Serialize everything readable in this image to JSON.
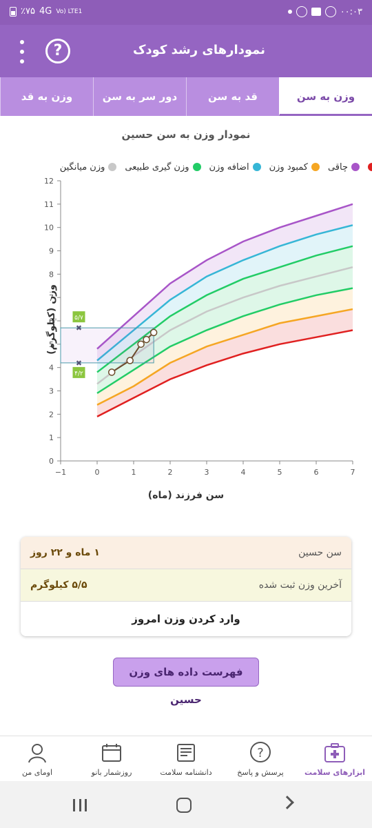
{
  "status_bar": {
    "battery": "٪۷۵",
    "network": "4G",
    "lte": "Vo) LTE1",
    "time": "۰۰:۰۳"
  },
  "app_bar": {
    "title": "نمودارهای رشد کودک",
    "help_icon": "?"
  },
  "tabs": [
    {
      "label": "وزن به سن",
      "active": true
    },
    {
      "label": "قد به سن",
      "active": false
    },
    {
      "label": "دور سر به سن",
      "active": false
    },
    {
      "label": "وزن به قد",
      "active": false
    }
  ],
  "chart": {
    "title": "نمودار وزن به سن حسین",
    "legend": [
      {
        "label": "چاقی",
        "color": "#a855c8"
      },
      {
        "label": "کمبود وزن",
        "color": "#f5a623"
      },
      {
        "label": "اضافه وزن",
        "color": "#36b6d6"
      },
      {
        "label": "وزن گیری طبیعی",
        "color": "#22cc66"
      },
      {
        "label": "وزن میانگین",
        "color": "#c8c8c8"
      }
    ],
    "ylabel": "وزن (کیلوگرم)",
    "xlabel": "سن فرزند (ماه)",
    "marker_high": "۵/۷",
    "marker_low": "۴/۲"
  },
  "chart_data": {
    "type": "line",
    "xlim": [
      -1,
      7
    ],
    "ylim": [
      0,
      12
    ],
    "x_ticks": [
      -1,
      0,
      1,
      2,
      3,
      4,
      5,
      6,
      7
    ],
    "y_ticks": [
      0,
      1,
      2,
      3,
      4,
      5,
      6,
      7,
      8,
      9,
      10,
      11,
      12
    ],
    "x": [
      0,
      1,
      2,
      3,
      4,
      5,
      6,
      7
    ],
    "series": [
      {
        "name": "چاقی",
        "color": "#a855c8",
        "values": [
          4.8,
          6.2,
          7.6,
          8.6,
          9.4,
          10.0,
          10.5,
          11.0
        ]
      },
      {
        "name": "اضافه وزن",
        "color": "#36b6d6",
        "values": [
          4.3,
          5.6,
          6.9,
          7.9,
          8.6,
          9.2,
          9.7,
          10.1
        ]
      },
      {
        "name": "وزن گیری طبیعی",
        "color": "#22cc66",
        "values": [
          3.8,
          5.0,
          6.2,
          7.1,
          7.8,
          8.3,
          8.8,
          9.2
        ]
      },
      {
        "name": "وزن میانگین",
        "color": "#c8c8c8",
        "values": [
          3.3,
          4.5,
          5.6,
          6.4,
          7.0,
          7.5,
          7.9,
          8.3
        ]
      },
      {
        "name": "",
        "color": "#22cc66",
        "values": [
          2.9,
          3.9,
          4.9,
          5.6,
          6.2,
          6.7,
          7.1,
          7.4
        ]
      },
      {
        "name": "کمبود وزن",
        "color": "#f5a623",
        "values": [
          2.4,
          3.2,
          4.2,
          4.9,
          5.4,
          5.9,
          6.2,
          6.5
        ]
      },
      {
        "name": "",
        "color": "#e02020",
        "values": [
          1.9,
          2.7,
          3.5,
          4.1,
          4.6,
          5.0,
          5.3,
          5.6
        ]
      }
    ],
    "child_points": {
      "x": [
        0.4,
        0.9,
        1.2,
        1.35,
        1.55
      ],
      "y": [
        3.8,
        4.3,
        5.0,
        5.2,
        5.5
      ]
    },
    "range_box": {
      "x": [
        -1,
        1.55
      ],
      "y": [
        4.2,
        5.7
      ]
    }
  },
  "info": {
    "age_label": "سن حسین",
    "age_value": "۱ ماه و ۲۲ روز",
    "weight_label": "آخرین وزن ثبت شده",
    "weight_value": "۵/۵ کیلوگرم",
    "enter_today": "وارد کردن وزن امروز"
  },
  "list_button": "فهرست داده های وزن حسین",
  "bottom_nav": [
    {
      "label": "ابزارهای سلامت",
      "icon": "health-kit-icon",
      "active": true
    },
    {
      "label": "پرسش و پاسخ",
      "icon": "question-icon",
      "active": false
    },
    {
      "label": "دانشنامه سلامت",
      "icon": "encyclopedia-icon",
      "active": false
    },
    {
      "label": "روزشمار بانو",
      "icon": "calendar-icon",
      "active": false
    },
    {
      "label": "اومای من",
      "icon": "profile-icon",
      "active": false
    }
  ]
}
